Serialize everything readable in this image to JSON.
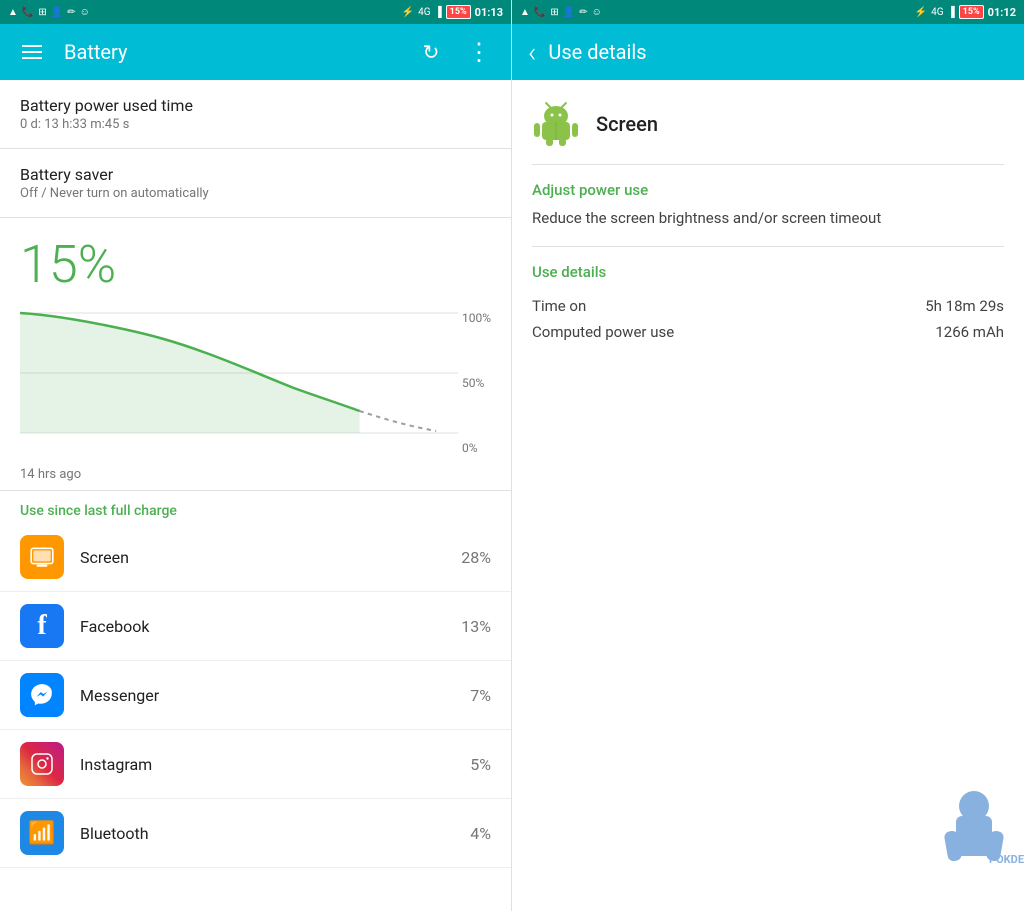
{
  "left_statusbar": {
    "time": "01:13",
    "battery_pct": "15%",
    "icons": [
      "notification",
      "phone",
      "screenshot",
      "person",
      "edit",
      "circle"
    ]
  },
  "right_statusbar": {
    "time": "01:12",
    "battery_pct": "15%",
    "icons": [
      "notification",
      "phone",
      "screenshot",
      "person",
      "edit",
      "circle"
    ]
  },
  "left_toolbar": {
    "menu_icon": "☰",
    "title": "Battery",
    "refresh_icon": "↻",
    "more_icon": "⋮"
  },
  "battery_info": {
    "power_used_title": "Battery power used time",
    "power_used_value": "0 d: 13 h:33 m:45 s",
    "saver_title": "Battery saver",
    "saver_value": "Off / Never turn on automatically",
    "percent": "15%",
    "chart_time": "14 hrs ago",
    "chart_labels": [
      "100%",
      "50%",
      "0%"
    ],
    "use_since_label": "Use since last full charge"
  },
  "app_list": [
    {
      "name": "Screen",
      "percent": "28%",
      "icon_type": "screen"
    },
    {
      "name": "Facebook",
      "percent": "13%",
      "icon_type": "facebook"
    },
    {
      "name": "Messenger",
      "percent": "7%",
      "icon_type": "messenger"
    },
    {
      "name": "Instagram",
      "percent": "5%",
      "icon_type": "instagram"
    },
    {
      "name": "Bluetooth",
      "percent": "4%",
      "icon_type": "bluetooth"
    }
  ],
  "right_toolbar": {
    "back_icon": "‹",
    "title": "Use details"
  },
  "use_details": {
    "app_name": "Screen",
    "adjust_label": "Adjust power use",
    "adjust_text": "Reduce the screen brightness and/or screen timeout",
    "use_details_label": "Use details",
    "time_on_label": "Time on",
    "time_on_value": "5h 18m 29s",
    "computed_power_label": "Computed power use",
    "computed_power_value": "1266 mAh"
  }
}
